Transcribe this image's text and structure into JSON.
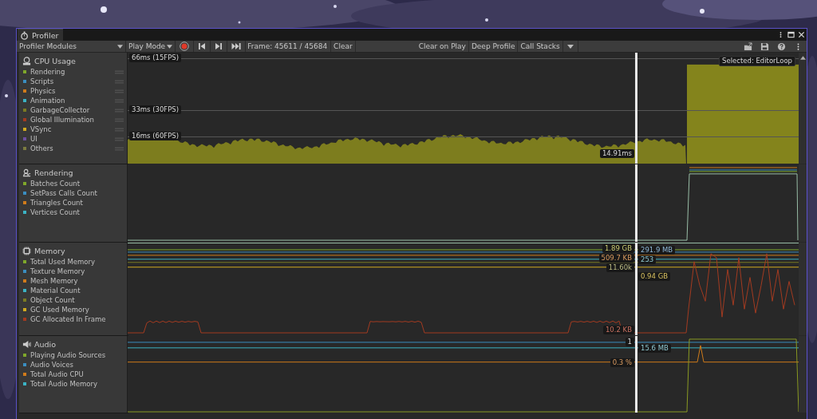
{
  "window": {
    "tab_title": "Profiler"
  },
  "toolbar": {
    "modules_dropdown": "Profiler Modules",
    "play_mode": "Play Mode",
    "recording": true,
    "frame": "Frame: 45611 / 45684",
    "clear": "Clear",
    "clear_on_play": "Clear on Play",
    "deep_profile": "Deep Profile",
    "call_stacks": "Call Stacks"
  },
  "modules": [
    {
      "kind": "cpu",
      "title": "CPU Usage",
      "items": [
        {
          "label": "Rendering",
          "color": "#7fa82a"
        },
        {
          "label": "Scripts",
          "color": "#3a8ec0"
        },
        {
          "label": "Physics",
          "color": "#d07b1a"
        },
        {
          "label": "Animation",
          "color": "#3bb3c4"
        },
        {
          "label": "GarbageCollector",
          "color": "#7b7b22"
        },
        {
          "label": "Global Illumination",
          "color": "#a33a20"
        },
        {
          "label": "VSync",
          "color": "#d0aa20"
        },
        {
          "label": "UI",
          "color": "#6d4fa0"
        },
        {
          "label": "Others",
          "color": "#7b7b40"
        }
      ],
      "grid_labels": [
        "66ms (15FPS)",
        "33ms (30FPS)",
        "16ms (60FPS)"
      ],
      "value_labels": [
        "14.91ms"
      ],
      "selected_label": "Selected: EditorLoop"
    },
    {
      "kind": "rendering",
      "title": "Rendering",
      "items": [
        {
          "label": "Batches Count",
          "color": "#7fa82a"
        },
        {
          "label": "SetPass Calls Count",
          "color": "#3a8ec0"
        },
        {
          "label": "Triangles Count",
          "color": "#d07b1a"
        },
        {
          "label": "Vertices Count",
          "color": "#3bb3c4"
        }
      ]
    },
    {
      "kind": "memory",
      "title": "Memory",
      "items": [
        {
          "label": "Total Used Memory",
          "color": "#7fa82a"
        },
        {
          "label": "Texture Memory",
          "color": "#3a8ec0"
        },
        {
          "label": "Mesh Memory",
          "color": "#d07b1a"
        },
        {
          "label": "Material Count",
          "color": "#3bb3c4"
        },
        {
          "label": "Object Count",
          "color": "#7b7b22"
        },
        {
          "label": "GC Used Memory",
          "color": "#d0aa20"
        },
        {
          "label": "GC Allocated In Frame",
          "color": "#a33a20"
        }
      ],
      "value_labels": [
        "1.89 GB",
        "291.9 MB",
        "509.7 KB",
        "253",
        "11.60k",
        "0.94 GB",
        "10.2 KB"
      ]
    },
    {
      "kind": "audio",
      "title": "Audio",
      "items": [
        {
          "label": "Playing Audio Sources",
          "color": "#7fa82a"
        },
        {
          "label": "Audio Voices",
          "color": "#3a8ec0"
        },
        {
          "label": "Total Audio CPU",
          "color": "#d07b1a"
        },
        {
          "label": "Total Audio Memory",
          "color": "#3bb3c4"
        }
      ],
      "value_labels": [
        "1",
        "15.6 MB",
        "0.3 %"
      ]
    }
  ]
}
